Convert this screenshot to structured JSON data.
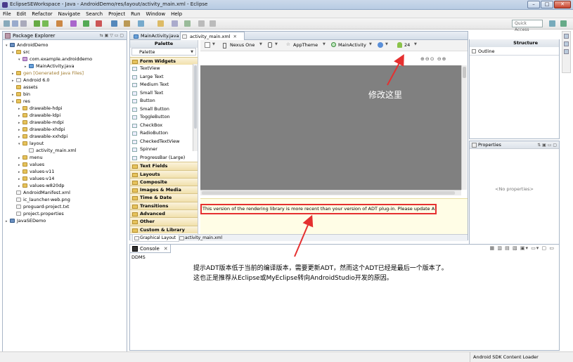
{
  "window": {
    "title": "EclipseSEWorkspace - Java - AndroidDemo/res/layout/activity_main.xml - Eclipse"
  },
  "menu": [
    "File",
    "Edit",
    "Refactor",
    "Navigate",
    "Search",
    "Project",
    "Run",
    "Window",
    "Help"
  ],
  "toolbar": {
    "quick_access": "Quick Access"
  },
  "package_explorer": {
    "title": "Package Explorer",
    "tree": [
      {
        "label": "AndroidDemo",
        "depth": 0,
        "icon": "proj",
        "tri": "▾"
      },
      {
        "label": "src",
        "depth": 1,
        "icon": "folder",
        "tri": "▾"
      },
      {
        "label": "com.example.androiddemo",
        "depth": 2,
        "icon": "pkg",
        "tri": "▾"
      },
      {
        "label": "MainActivity.java",
        "depth": 3,
        "icon": "java",
        "tri": "▸"
      },
      {
        "label": "gen [Generated Java Files]",
        "depth": 1,
        "icon": "folder",
        "tri": "▸"
      },
      {
        "label": "Android 6.0",
        "depth": 1,
        "icon": "file",
        "tri": "▸"
      },
      {
        "label": "assets",
        "depth": 1,
        "icon": "folder",
        "tri": ""
      },
      {
        "label": "bin",
        "depth": 1,
        "icon": "folder",
        "tri": "▸"
      },
      {
        "label": "res",
        "depth": 1,
        "icon": "folder",
        "tri": "▾"
      },
      {
        "label": "drawable-hdpi",
        "depth": 2,
        "icon": "folder",
        "tri": "▸"
      },
      {
        "label": "drawable-ldpi",
        "depth": 2,
        "icon": "folder",
        "tri": "▸"
      },
      {
        "label": "drawable-mdpi",
        "depth": 2,
        "icon": "folder",
        "tri": "▸"
      },
      {
        "label": "drawable-xhdpi",
        "depth": 2,
        "icon": "folder",
        "tri": "▸"
      },
      {
        "label": "drawable-xxhdpi",
        "depth": 2,
        "icon": "folder",
        "tri": "▸"
      },
      {
        "label": "layout",
        "depth": 2,
        "icon": "folder",
        "tri": "▾"
      },
      {
        "label": "activity_main.xml",
        "depth": 3,
        "icon": "file",
        "tri": ""
      },
      {
        "label": "menu",
        "depth": 2,
        "icon": "folder",
        "tri": "▸"
      },
      {
        "label": "values",
        "depth": 2,
        "icon": "folder",
        "tri": "▸"
      },
      {
        "label": "values-v11",
        "depth": 2,
        "icon": "folder",
        "tri": "▸"
      },
      {
        "label": "values-v14",
        "depth": 2,
        "icon": "folder",
        "tri": "▸"
      },
      {
        "label": "values-w820dp",
        "depth": 2,
        "icon": "folder",
        "tri": "▸"
      },
      {
        "label": "AndroidManifest.xml",
        "depth": 1,
        "icon": "file",
        "tri": ""
      },
      {
        "label": "ic_launcher-web.png",
        "depth": 1,
        "icon": "file",
        "tri": ""
      },
      {
        "label": "proguard-project.txt",
        "depth": 1,
        "icon": "file",
        "tri": ""
      },
      {
        "label": "project.properties",
        "depth": 1,
        "icon": "file",
        "tri": ""
      },
      {
        "label": "JavaSEDemo",
        "depth": 0,
        "icon": "proj",
        "tri": "▸"
      }
    ]
  },
  "editor": {
    "tabs": [
      "MainActivity.java",
      "activity_main.xml"
    ],
    "toolbar": {
      "device": "Nexus One",
      "theme": "AppTheme",
      "activity": "MainActivity",
      "api": "24"
    },
    "palette": {
      "header": "Palette",
      "sub": "Palette",
      "group": "Form Widgets",
      "items": [
        "TextView",
        "Large Text",
        "Medium Text",
        "Small Text",
        "Button",
        "Small Button",
        "ToggleButton",
        "CheckBox",
        "RadioButton",
        "CheckedTextView",
        "Spinner",
        "ProgressBar (Large)"
      ],
      "categories": [
        "Text Fields",
        "Layouts",
        "Composite",
        "Images & Media",
        "Time & Date",
        "Transitions",
        "Advanced",
        "Other",
        "Custom & Library Views"
      ]
    },
    "error_message": "This version of the rendering library is more recent than your version of ADT plug-in. Please update ADT plug-in",
    "bottom_tabs": [
      "Graphical Layout",
      "activity_main.xml"
    ]
  },
  "structure": {
    "title": "Structure",
    "outline": "Outline"
  },
  "properties": {
    "title": "Properties",
    "empty": "<No properties>"
  },
  "console": {
    "title": "Console",
    "text": "DDMS"
  },
  "status": {
    "text": "Android SDK Content Loader"
  },
  "annotations": {
    "top": "修改这里",
    "bottom_line1": "提示ADT版本低于当前的编译版本，需要更新ADT，然而这个ADT已经是最后一个版本了。",
    "bottom_line2": "这也正是推荐从Eclipse或MyEclipse转向AndroidStudio开发的原因。"
  },
  "colors": {
    "highlight": "#e53030",
    "canvas": "#808080",
    "annotation_text": "#ffffff"
  }
}
